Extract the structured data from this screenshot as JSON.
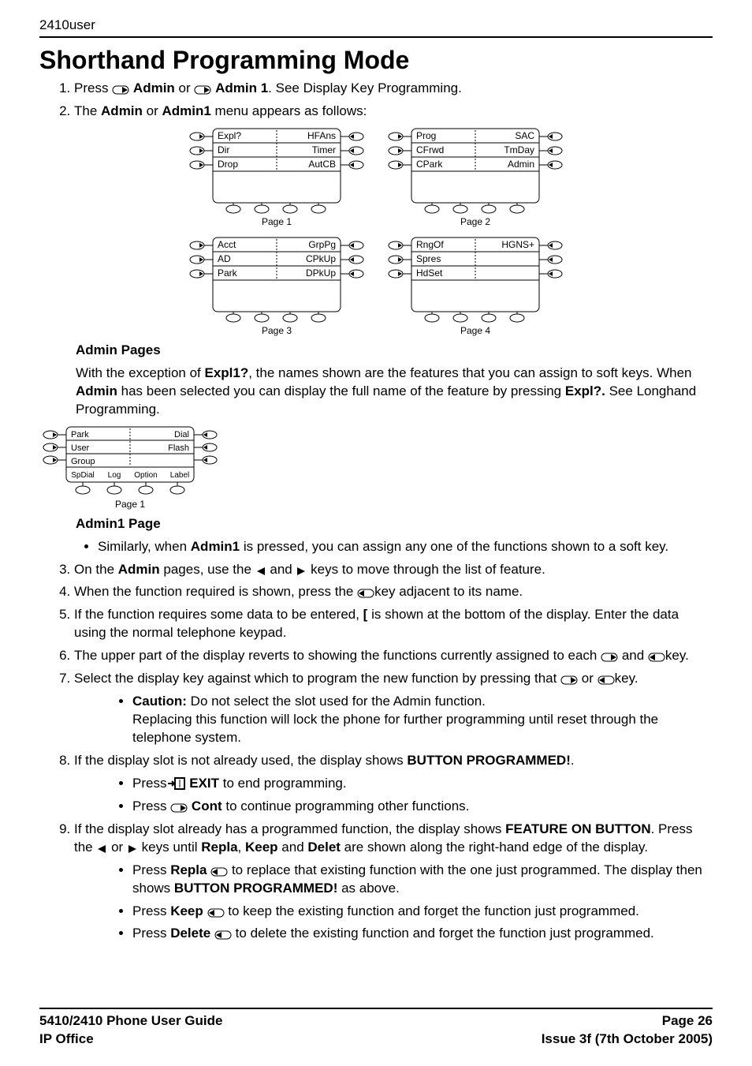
{
  "header": {
    "doc_id": "2410user"
  },
  "title": "Shorthand Programming Mode",
  "ol": {
    "i1_a": "Press ",
    "i1_b": " or ",
    "i1_c": ". See Display Key Programming.",
    "admin": "Admin",
    "admin1": "Admin 1",
    "i2_a": "The ",
    "i2_b": " or ",
    "i2_c": " menu appears as follows:",
    "admin1nb": "Admin1"
  },
  "adminPagesLabel": "Admin Pages",
  "admin1PageLabel": "Admin1 Page",
  "adminPagesPara": {
    "a": "With the exception of ",
    "expl1q": "Expl1?",
    "b": ", the names shown are the features that you can assign to soft keys. When ",
    "admin": "Admin",
    "c": " has been selected you can display the full name of the feature by pressing ",
    "explq": "Expl?.",
    "d": " See Longhand Programming."
  },
  "admin1bullet": {
    "a": "Similarly, when ",
    "admin1": "Admin1",
    "b": " is pressed, you can assign any one of the functions shown to a soft key."
  },
  "step3": {
    "a": "On the ",
    "admin": "Admin",
    "b": " pages, use the ",
    "c": " and ",
    "d": " keys to move through the list of feature."
  },
  "step4": {
    "a": "When the function required is shown, press the ",
    "b": "key adjacent to its name."
  },
  "step5": {
    "a": "If the function requires some data to be entered, ",
    "bracket": "[",
    "b": " is shown at the bottom of the display. Enter the data using the normal telephone keypad."
  },
  "step6": {
    "a": "The upper part of the display reverts to showing the functions currently assigned to each ",
    "b": " and ",
    "c": "key."
  },
  "step7": {
    "a": "Select the display key against which to program the new function by pressing that ",
    "b": " or ",
    "c": "key."
  },
  "caution": {
    "label": "Caution:",
    "a": "  Do not select the slot used for the Admin function.",
    "b": "Replacing this function will lock the phone for further programming until reset through the telephone system."
  },
  "step8": {
    "a": "If the display slot is not already used, the display shows ",
    "bp": "BUTTON PROGRAMMED!",
    "b": "."
  },
  "step8bul": {
    "exit_a": "Press",
    "exit_lbl": "EXIT",
    "exit_b": " to end programming.",
    "cont_a": "Press ",
    "cont_lbl": "Cont",
    "cont_b": " to continue programming other functions."
  },
  "step9": {
    "a": "If the display slot already has a programmed function, the display shows ",
    "fob": "FEATURE ON BUTTON",
    "b": ". Press the ",
    "c": " or ",
    "d": " keys until ",
    "repla": "Repla",
    "e": ", ",
    "keep": "Keep",
    "f": " and ",
    "delet": "Delet",
    "g": " are shown along the right-hand edge of the display."
  },
  "step9bul": {
    "repla_a": "Press ",
    "repla_lbl": "Repla",
    "repla_b": " to replace that existing function with the one just programmed. The display then shows ",
    "repla_bp": "BUTTON PROGRAMMED!",
    "repla_c": " as above.",
    "keep_a": "Press ",
    "keep_lbl": "Keep",
    "keep_b": " to keep the existing function and forget the function just programmed.",
    "delete_a": "Press ",
    "delete_lbl": "Delete",
    "delete_b": " to delete the existing function and forget the function just programmed."
  },
  "lcd": {
    "p1": {
      "l1a": "Expl?",
      "l1b": "HFAns",
      "l2a": "Dir",
      "l2b": "Timer",
      "l3a": "Drop",
      "l3b": "AutCB",
      "caption": "Page 1"
    },
    "p2": {
      "l1a": "Prog",
      "l1b": "SAC",
      "l2a": "CFrwd",
      "l2b": "TmDay",
      "l3a": "CPark",
      "l3b": "Admin",
      "caption": "Page 2"
    },
    "p3": {
      "l1a": "Acct",
      "l1b": "GrpPg",
      "l2a": "AD",
      "l2b": "CPkUp",
      "l3a": "Park",
      "l3b": "DPkUp",
      "caption": "Page 3"
    },
    "p4": {
      "l1a": "RngOf",
      "l1b": "HGNS+",
      "l2a": "Spres",
      "l2b": "",
      "l3a": "HdSet",
      "l3b": "",
      "caption": "Page 4"
    },
    "p5": {
      "l1a": "Park",
      "l1b": "Dial",
      "l2a": "User",
      "l2b": "Flash",
      "l3a": "Group",
      "l3b": "",
      "sk1": "SpDial",
      "sk2": "Log",
      "sk3": "Option",
      "sk4": "Label",
      "caption": "Page 1"
    }
  },
  "footer": {
    "left1": "5410/2410 Phone User Guide",
    "left2": "IP Office",
    "right1": "Page 26",
    "right2": "Issue 3f (7th October 2005)"
  }
}
